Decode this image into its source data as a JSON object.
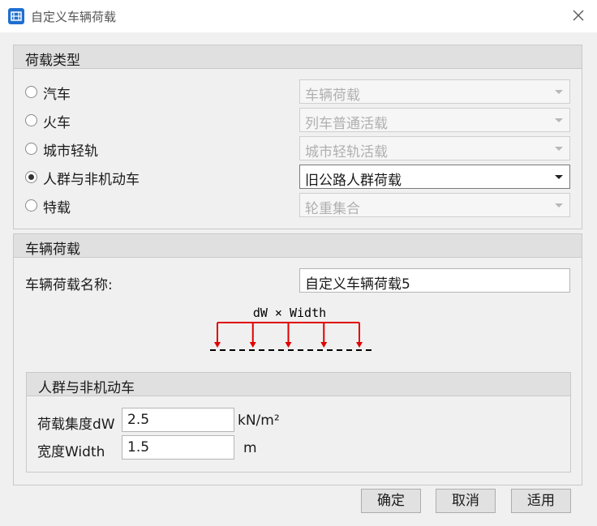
{
  "window": {
    "title": "自定义车辆荷载"
  },
  "load_type": {
    "title": "荷载类型",
    "options": [
      {
        "label": "汽车",
        "combo_value": "车辆荷载",
        "checked": false,
        "enabled": false
      },
      {
        "label": "火车",
        "combo_value": "列车普通活载",
        "checked": false,
        "enabled": false
      },
      {
        "label": "城市轻轨",
        "combo_value": "城市轻轨活载",
        "checked": false,
        "enabled": false
      },
      {
        "label": "人群与非机动车",
        "combo_value": "旧公路人群荷载",
        "checked": true,
        "enabled": true
      },
      {
        "label": "特载",
        "combo_value": "轮重集合",
        "checked": false,
        "enabled": false
      }
    ]
  },
  "vehicle_load": {
    "title": "车辆荷载",
    "name_label": "车辆荷载名称:",
    "name_value": "自定义车辆荷载5",
    "diagram_label": "dW × Width",
    "diagram_arrow_count": 5,
    "diagram_color": "#e00000"
  },
  "crowd": {
    "title": "人群与非机动车",
    "density_label": "荷载集度dW",
    "density_value": "2.5",
    "density_unit": "kN/m²",
    "width_label": "宽度Width",
    "width_value": "1.5",
    "width_unit": "m"
  },
  "buttons": {
    "ok": "确定",
    "cancel": "取消",
    "apply": "适用"
  }
}
